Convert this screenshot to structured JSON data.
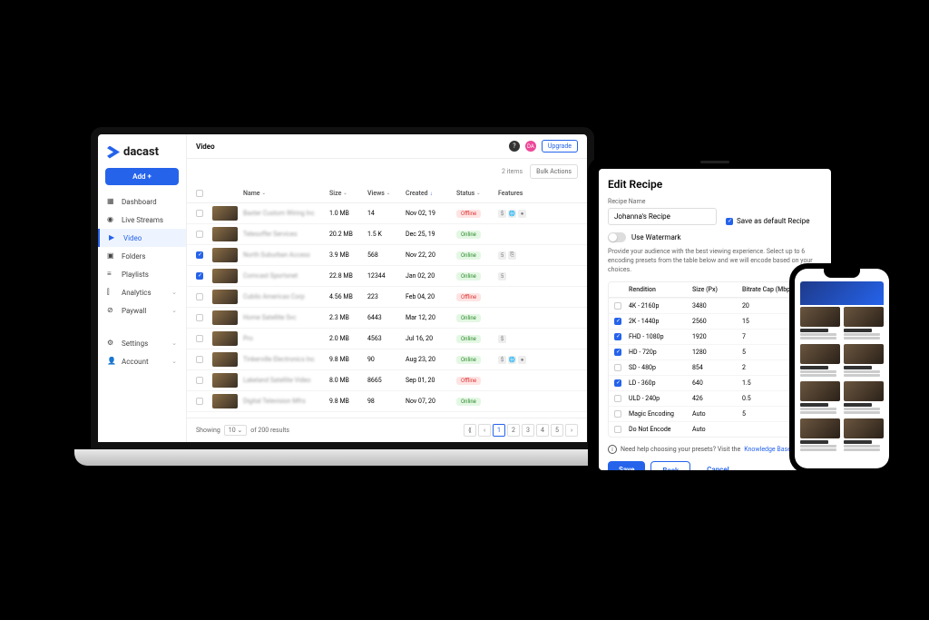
{
  "logo_text": "dacast",
  "add_button": "Add +",
  "nav": [
    {
      "label": "Dashboard",
      "icon": "dashboard"
    },
    {
      "label": "Live Streams",
      "icon": "live"
    },
    {
      "label": "Video",
      "icon": "video",
      "active": true
    },
    {
      "label": "Folders",
      "icon": "folder"
    },
    {
      "label": "Playlists",
      "icon": "playlist"
    },
    {
      "label": "Analytics",
      "icon": "analytics",
      "expandable": true
    },
    {
      "label": "Paywall",
      "icon": "paywall",
      "expandable": true
    }
  ],
  "nav_bottom": [
    {
      "label": "Settings",
      "icon": "settings",
      "expandable": true
    },
    {
      "label": "Account",
      "icon": "account",
      "expandable": true
    }
  ],
  "topbar": {
    "title": "Video",
    "upgrade": "Upgrade"
  },
  "toolbar": {
    "items_count": "2 items",
    "bulk": "Bulk Actions"
  },
  "columns": {
    "name": "Name",
    "size": "Size",
    "views": "Views",
    "created": "Created",
    "status": "Status",
    "features": "Features"
  },
  "rows": [
    {
      "checked": false,
      "name": "Baxter Custom Wiring Inc",
      "size": "1.0 MB",
      "views": "14",
      "created": "Nov 02, 19",
      "status": "Offline",
      "features": [
        "$",
        "🌐",
        "●"
      ]
    },
    {
      "checked": false,
      "name": "Telesoffer Services",
      "size": "20.2 MB",
      "views": "1.5 K",
      "created": "Dec 25, 19",
      "status": "Online",
      "features": []
    },
    {
      "checked": true,
      "name": "North Suburban Access",
      "size": "3.9 MB",
      "views": "568",
      "created": "Nov 22, 20",
      "status": "Online",
      "features": [
        "5",
        "⎘"
      ]
    },
    {
      "checked": true,
      "name": "Comcast Sportsnet",
      "size": "22.8 MB",
      "views": "12344",
      "created": "Jan 02, 20",
      "status": "Online",
      "features": [
        "5"
      ]
    },
    {
      "checked": false,
      "name": "Cubilo Americas Corp",
      "size": "4.56 MB",
      "views": "223",
      "created": "Feb 04, 20",
      "status": "Offline",
      "features": []
    },
    {
      "checked": false,
      "name": "Home Satellite Svc",
      "size": "2.3 MB",
      "views": "6443",
      "created": "Mar 12, 20",
      "status": "Online",
      "features": []
    },
    {
      "checked": false,
      "name": "Pro",
      "size": "2.0 MB",
      "views": "4563",
      "created": "Jul 16, 20",
      "status": "Online",
      "features": [
        "$"
      ]
    },
    {
      "checked": false,
      "name": "Tinkerville Electronics Inc",
      "size": "9.8 MB",
      "views": "90",
      "created": "Aug 23, 20",
      "status": "Online",
      "features": [
        "$",
        "🌐",
        "●"
      ]
    },
    {
      "checked": false,
      "name": "Lakeland Satellite Video",
      "size": "8.0 MB",
      "views": "8665",
      "created": "Sep 01, 20",
      "status": "Offline",
      "features": []
    },
    {
      "checked": false,
      "name": "Digital Television Mfrs",
      "size": "9.8 MB",
      "views": "98",
      "created": "Nov 07, 20",
      "status": "Online",
      "features": []
    }
  ],
  "footer": {
    "showing": "Showing",
    "per_page": "10",
    "of": "of 200 results",
    "pages": [
      "1",
      "2",
      "3",
      "4",
      "5"
    ]
  },
  "recipe": {
    "title": "Edit Recipe",
    "name_label": "Recipe Name",
    "name_value": "Johanna's Recipe",
    "save_default_label": "Save as default Recipe",
    "watermark_label": "Use Watermark",
    "desc": "Provide your audience with the best viewing experience. Select up to 6 encoding presets from the table below and we will encode based on your choices.",
    "columns": {
      "rendition": "Rendition",
      "size": "Size (Px)",
      "bitrate": "Bitrate Cap (Mbps)"
    },
    "rows": [
      {
        "checked": false,
        "name": "4K - 2160p",
        "size": "3480",
        "bitrate": "20"
      },
      {
        "checked": true,
        "name": "2K - 1440p",
        "size": "2560",
        "bitrate": "15"
      },
      {
        "checked": true,
        "name": "FHD - 1080p",
        "size": "1920",
        "bitrate": "7"
      },
      {
        "checked": true,
        "name": "HD - 720p",
        "size": "1280",
        "bitrate": "5"
      },
      {
        "checked": false,
        "name": "SD - 480p",
        "size": "854",
        "bitrate": "2"
      },
      {
        "checked": true,
        "name": "LD - 360p",
        "size": "640",
        "bitrate": "1.5"
      },
      {
        "checked": false,
        "name": "ULD - 240p",
        "size": "426",
        "bitrate": "0.5"
      },
      {
        "checked": false,
        "name": "Magic Encoding",
        "size": "Auto",
        "bitrate": "5"
      },
      {
        "checked": false,
        "name": "Do Not Encode",
        "size": "Auto",
        "bitrate": ""
      }
    ],
    "help_text": "Need help choosing your presets? Visit the",
    "help_link": "Knowledge Base",
    "save": "Save",
    "back": "Back",
    "cancel": "Cancel"
  }
}
